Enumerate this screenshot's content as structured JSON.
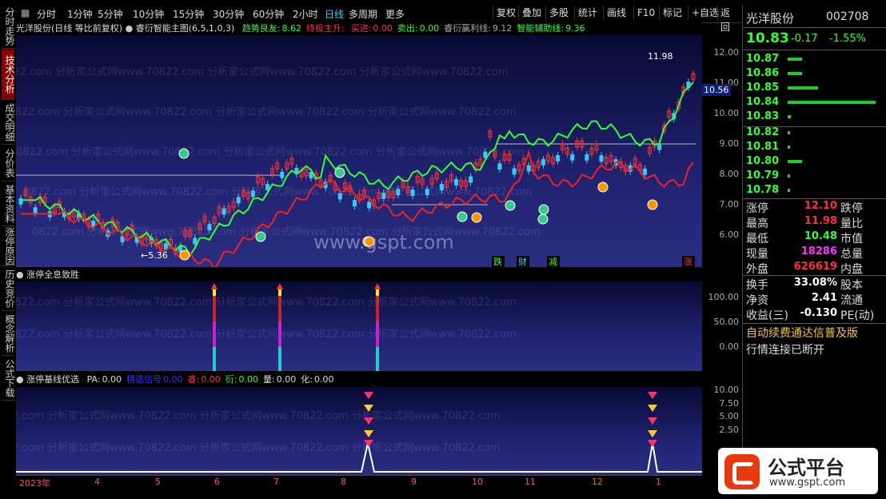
{
  "left_tabs": [
    "分时走势",
    "技术分析",
    "成交明细",
    "分价表",
    "基本资料",
    "涨停原因",
    "历史竞价",
    "概念解析",
    "公式下载"
  ],
  "toolbar": {
    "periods": [
      "分时",
      "1分钟",
      "5分钟",
      "10分钟",
      "15分钟",
      "30分钟",
      "60分钟",
      "2小时",
      "日线",
      "多周期",
      "更多"
    ],
    "selected": "日线",
    "right_buttons": [
      "复权",
      "叠加",
      "多股",
      "统计",
      "画线",
      "F10",
      "标记",
      "+自选",
      "返回"
    ]
  },
  "main_title": {
    "stock": "光洋股份(日线 等比前复权)",
    "indicator": "睿衍智能主图(6,5,1,0,3)",
    "items": [
      {
        "label": "趋势良友:",
        "value": "8.62",
        "color": "#3f3"
      },
      {
        "label": "终极主升:",
        "value": "",
        "color": "#f33"
      },
      {
        "label": "买进:",
        "value": "0.00",
        "color": "#f33"
      },
      {
        "label": "卖出:",
        "value": "0.00",
        "color": "#3f3"
      },
      {
        "label": "睿衍赢利线:",
        "value": "9.12",
        "color": "#aaa"
      },
      {
        "label": "智能辅助线:",
        "value": "9.36",
        "color": "#3f3"
      }
    ]
  },
  "main_axis": [
    "12.00",
    "11.00",
    "10.00",
    "9.00",
    "8.00",
    "7.00",
    "6.00"
  ],
  "main_axis_values": [
    12,
    11,
    10,
    9,
    8,
    7,
    6
  ],
  "price_labels": {
    "high": "11.98",
    "low": "5.36",
    "current": "10.56"
  },
  "markers": {
    "die": "跌",
    "cai": "财",
    "jian": "减",
    "zhang": "涨"
  },
  "watermark": "0822.com 分析家公式网www.70822.com 分析家公式网www.70822.com 分析家公式网www.70822.com",
  "site_watermark": "www.gspt.com",
  "pane2": {
    "title": "涨停全息致胜",
    "axis": [
      "100.00",
      "50.00",
      "0.00"
    ]
  },
  "pane3": {
    "title": "涨停基线优选",
    "items": [
      {
        "label": "PA:",
        "value": "0.00",
        "color": "#ddd"
      },
      {
        "label": "精选信号",
        "value": "0.00",
        "color": "#33f"
      },
      {
        "label": "睿:",
        "value": "0.00",
        "color": "#f33"
      },
      {
        "label": "衍:",
        "value": "0.00",
        "color": "#3f3"
      },
      {
        "label": "量:",
        "value": "0.00",
        "color": "#ddd"
      },
      {
        "label": "化:",
        "value": "0.00",
        "color": "#ddd"
      }
    ],
    "axis": [
      "10.00",
      "7.50",
      "5.00",
      "2.50"
    ]
  },
  "months": [
    "2023年",
    "4",
    "5",
    "6",
    "7",
    "8",
    "9",
    "10",
    "11",
    "12",
    "1"
  ],
  "right_panel": {
    "name": "光洋股份",
    "code": "002708",
    "price": "10.83",
    "change": "-0.17",
    "pct": "-1.55%",
    "sell": [
      {
        "p": "10.87",
        "w": 18
      },
      {
        "p": "10.86",
        "w": 18
      },
      {
        "p": "10.85",
        "w": 38
      },
      {
        "p": "10.84",
        "w": 110
      },
      {
        "p": "10.83",
        "w": 4
      }
    ],
    "buy": [
      {
        "p": "10.82",
        "w": 3
      },
      {
        "p": "10.81",
        "w": 3
      },
      {
        "p": "10.80",
        "w": 18
      },
      {
        "p": "10.79",
        "w": 3
      },
      {
        "p": "10.78",
        "w": 3
      }
    ],
    "stats1": [
      {
        "l": "涨停",
        "v": "12.10",
        "c": "#f33",
        "r": "跌停"
      },
      {
        "l": "最高",
        "v": "11.98",
        "c": "#f33",
        "r": "量比"
      },
      {
        "l": "最低",
        "v": "10.48",
        "c": "#3f3",
        "r": "市值"
      },
      {
        "l": "现量",
        "v": "18286",
        "c": "#f3f",
        "r": "总量"
      },
      {
        "l": "外盘",
        "v": "626619",
        "c": "#f33",
        "r": "内盘"
      }
    ],
    "stats2": [
      {
        "l": "换手",
        "v": "33.08%",
        "c": "#fff",
        "r": "股本"
      },
      {
        "l": "净资",
        "v": "2.41",
        "c": "#fff",
        "r": "流通"
      },
      {
        "l": "收益(三)",
        "v": "-0.130",
        "c": "#fff",
        "r": "PE(动)"
      }
    ],
    "notice1": "自动续费通达信普及版",
    "notice2": "行情连接已断开"
  },
  "logo": {
    "text": "公式平台",
    "url": "www.gspt.com"
  }
}
